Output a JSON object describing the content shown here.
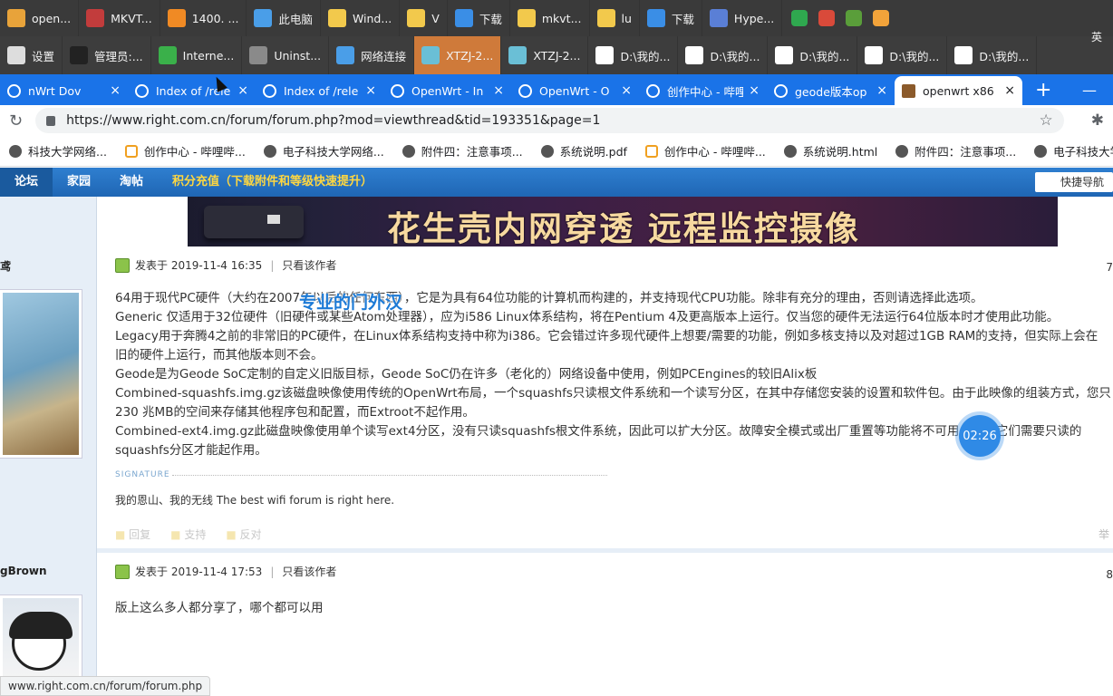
{
  "taskbar_row1": [
    {
      "label": "open...",
      "icon": "chrome-icon",
      "color": "#e8a33a"
    },
    {
      "label": "MKVT...",
      "icon": "mkv-icon",
      "color": "#c23c3c"
    },
    {
      "label": "1400. ...",
      "icon": "search-icon",
      "color": "#f08a24"
    },
    {
      "label": "此电脑",
      "icon": "computer-icon",
      "color": "#4a9ee8"
    },
    {
      "label": "Wind...",
      "icon": "folder-icon",
      "color": "#f2c94c"
    },
    {
      "label": "V",
      "icon": "folder-icon",
      "color": "#f2c94c"
    },
    {
      "label": "下载",
      "icon": "download-icon",
      "color": "#3a8ee6"
    },
    {
      "label": "mkvt...",
      "icon": "folder-icon",
      "color": "#f2c94c"
    },
    {
      "label": "lu",
      "icon": "folder-icon",
      "color": "#f2c94c"
    },
    {
      "label": "下载",
      "icon": "download-icon",
      "color": "#3a8ee6"
    },
    {
      "label": "Hype...",
      "icon": "hyper-icon",
      "color": "#5a7fd6"
    }
  ],
  "taskbar_row2": [
    {
      "label": "设置",
      "icon": "gear-icon",
      "color": "#dddddd"
    },
    {
      "label": "管理员:...",
      "icon": "terminal-icon",
      "color": "#222222"
    },
    {
      "label": "Interne...",
      "icon": "ie-icon",
      "color": "#3ab04a"
    },
    {
      "label": "Uninst...",
      "icon": "uninstall-icon",
      "color": "#8a8a8a"
    },
    {
      "label": "网络连接",
      "icon": "network-icon",
      "color": "#4a9ee8"
    },
    {
      "label": "XTZJ-2...",
      "icon": "vm-icon",
      "color": "#6abfd6",
      "active": true
    },
    {
      "label": "XTZJ-2...",
      "icon": "vm-icon",
      "color": "#6abfd6"
    },
    {
      "label": "D:\\我的...",
      "icon": "7zip-icon",
      "color": "#ffffff"
    },
    {
      "label": "D:\\我的...",
      "icon": "7zip-icon",
      "color": "#ffffff"
    },
    {
      "label": "D:\\我的...",
      "icon": "7zip-icon",
      "color": "#ffffff"
    },
    {
      "label": "D:\\我的...",
      "icon": "7zip-icon",
      "color": "#ffffff"
    },
    {
      "label": "D:\\我的...",
      "icon": "7zip-icon",
      "color": "#ffffff"
    }
  ],
  "ime_label": "英",
  "tabs": [
    {
      "title": "nWrt Dov",
      "active": false
    },
    {
      "title": "Index of /rele",
      "active": false
    },
    {
      "title": "Index of /rele",
      "active": false
    },
    {
      "title": "OpenWrt - In",
      "active": false
    },
    {
      "title": "OpenWrt - O",
      "active": false
    },
    {
      "title": "创作中心 - 哔哩",
      "active": false
    },
    {
      "title": "geode版本op",
      "active": false
    },
    {
      "title": "openwrt x86",
      "active": true
    }
  ],
  "tab_close": "×",
  "new_tab": "+",
  "address": {
    "url": "https://www.right.com.cn/forum/forum.php?mod=viewthread&tid=193351&page=1"
  },
  "bookmarks": [
    {
      "label": "科技大学网络...",
      "icon": "globe"
    },
    {
      "label": "创作中心 - 哔哩哔...",
      "icon": "bili"
    },
    {
      "label": "电子科技大学网络...",
      "icon": "globe"
    },
    {
      "label": "附件四：注意事项...",
      "icon": "globe"
    },
    {
      "label": "系统说明.pdf",
      "icon": "globe"
    },
    {
      "label": "创作中心 - 哔哩哔...",
      "icon": "bili"
    },
    {
      "label": "系统说明.html",
      "icon": "globe"
    },
    {
      "label": "附件四：注意事项...",
      "icon": "globe"
    },
    {
      "label": "电子科技大学网络...",
      "icon": "globe"
    }
  ],
  "site_nav": {
    "items": [
      "论坛",
      "家园",
      "淘帖",
      "积分充值（下载附件和等级快速提升）"
    ],
    "quick_nav": "快捷导航"
  },
  "banner": {
    "text": "花生壳内网穿透 远程监控摄像"
  },
  "post1": {
    "author": "鸢",
    "date": "发表于 2019-11-4 16:35",
    "only_author": "只看该作者",
    "num": "7",
    "lines": [
      "64用于现代PC硬件（大约在2007年以后的任何东西），它是为具有64位功能的计算机而构建的，并支持现代CPU功能。除非有充分的理由，否则请选择此选项。",
      "Generic  仅适用于32位硬件（旧硬件或某些Atom处理器），应为i586 Linux体系结构，将在Pentium 4及更高版本上运行。仅当您的硬件无法运行64位版本时才使用此功能。",
      "Legacy用于奔腾4之前的非常旧的PC硬件，在Linux体系结构支持中称为i386。它会错过许多现代硬件上想要/需要的功能，例如多核支持以及对超过1GB RAM的支持，但实际上会在",
      "旧的硬件上运行，而其他版本则不会。",
      "Geode是为Geode SoC定制的自定义旧版目标，Geode SoC仍在许多（老化的）网络设备中使用，例如PCEngines的较旧Alix板",
      "Combined-squashfs.img.gz该磁盘映像使用传统的OpenWrt布局，一个squashfs只读根文件系统和一个读写分区，在其中存储您安装的设置和软件包。由于此映像的组装方式，您只",
      "230 兆MB的空间来存储其他程序包和配置，而Extroot不起作用。",
      "Combined-ext4.img.gz此磁盘映像使用单个读写ext4分区，没有只读squashfs根文件系统，因此可以扩大分区。故障安全模式或出厂重置等功能将不可用，因为它们需要只读的",
      "squashfs分区才能起作用。"
    ],
    "signature_label": "SIGNATURE",
    "signature": "我的恩山、我的无线 The best wifi forum is right here.",
    "actions": [
      "回复",
      "支持",
      "反对"
    ],
    "end": "举"
  },
  "post2": {
    "author": "gBrown",
    "date": "发表于 2019-11-4 17:53",
    "only_author": "只看该作者",
    "num": "8",
    "text": "版上这么多人都分享了，哪个都可以用"
  },
  "video_overlay": {
    "title": "专业的门外汉",
    "timer": "02:26"
  },
  "status_url": "www.right.com.cn/forum/forum.php",
  "colors": {
    "tab_strip": "#1a73e8",
    "site_nav": "#1f66b4",
    "active_taskbar": "#cf7a3a"
  }
}
